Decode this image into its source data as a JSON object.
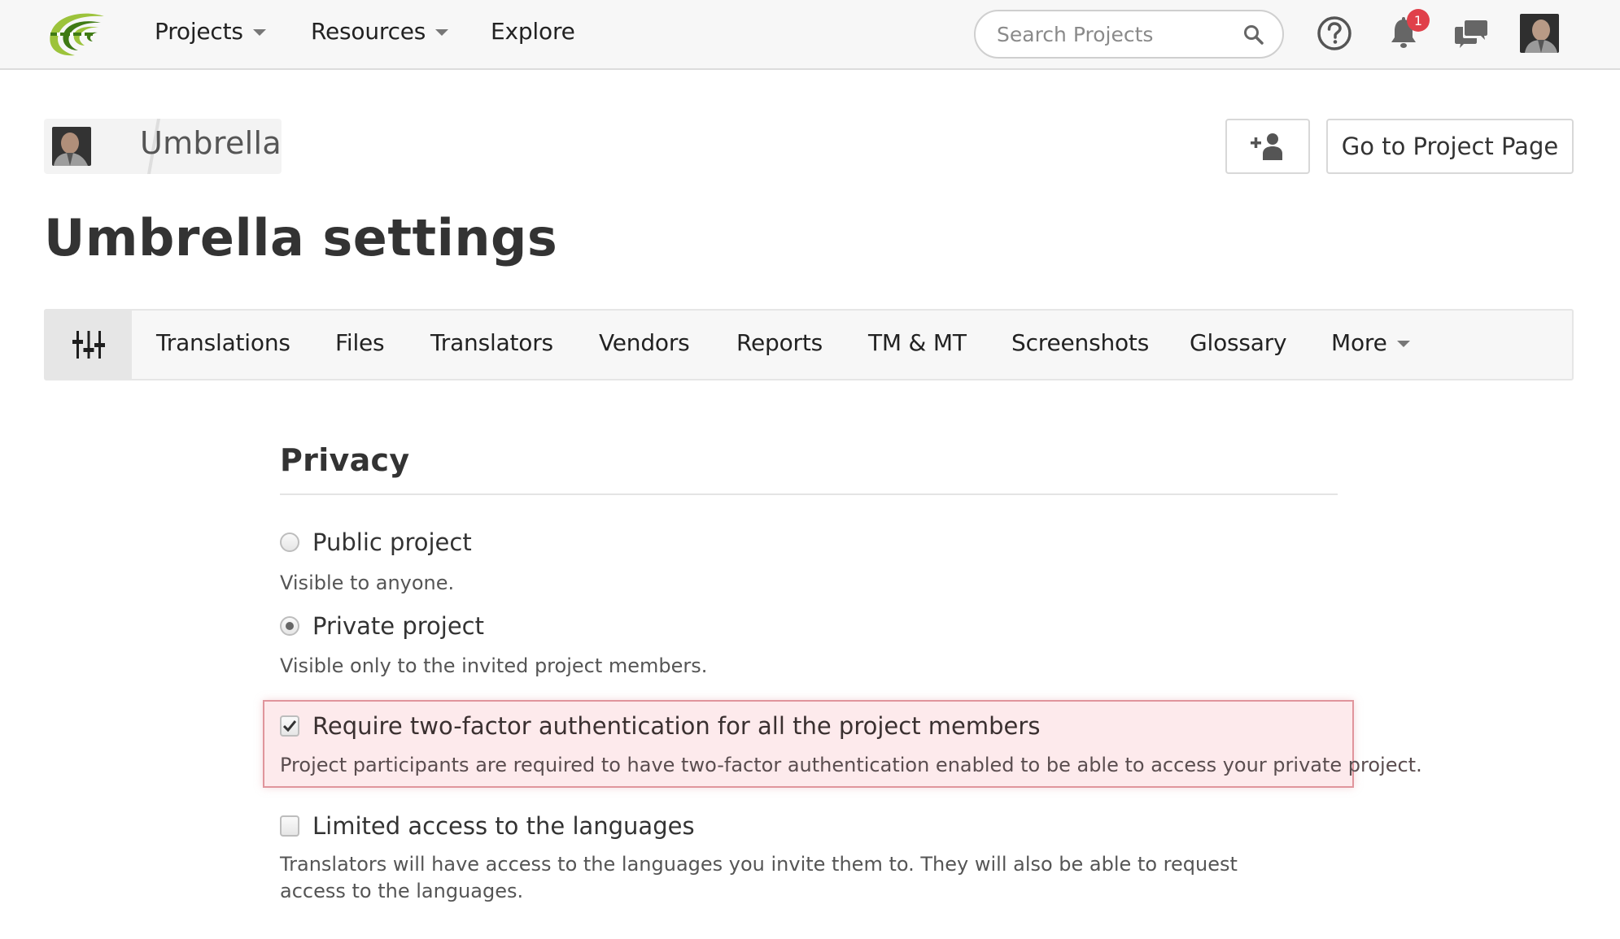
{
  "header": {
    "nav": [
      {
        "label": "Projects",
        "has_dropdown": true
      },
      {
        "label": "Resources",
        "has_dropdown": true
      },
      {
        "label": "Explore",
        "has_dropdown": false
      }
    ],
    "search": {
      "placeholder": "Search Projects",
      "value": ""
    },
    "icons": {
      "help": "help-circle-icon",
      "notifications": "bell-icon",
      "messages": "chat-bubbles-icon",
      "search": "magnifier-icon"
    },
    "notification_count": "1",
    "colors": {
      "badge": "#e0404a",
      "logo_green": "#9cc33b",
      "logo_dark_green": "#3f7a14"
    }
  },
  "breadcrumb": {
    "project_name": "Umbrella"
  },
  "actions": {
    "add_member_icon": "user-plus-icon",
    "go_to_project_label": "Go to Project Page"
  },
  "page": {
    "title": "Umbrella settings"
  },
  "tabs": {
    "settings_icon": "sliders-icon",
    "items": [
      {
        "label": "Translations"
      },
      {
        "label": "Files"
      },
      {
        "label": "Translators"
      },
      {
        "label": "Vendors"
      },
      {
        "label": "Reports"
      },
      {
        "label": "TM & MT"
      },
      {
        "label": "Screenshots"
      },
      {
        "label": "Glossary"
      },
      {
        "label": "More",
        "has_dropdown": true
      }
    ]
  },
  "privacy": {
    "title": "Privacy",
    "options": [
      {
        "label": "Public project",
        "description": "Visible to anyone.",
        "selected": false
      },
      {
        "label": "Private project",
        "description": "Visible only to the invited project members.",
        "selected": true
      }
    ],
    "two_factor": {
      "label": "Require two-factor authentication for all the project members",
      "description": "Project participants are required to have two-factor authentication enabled to be able to access your private project.",
      "checked": true,
      "highlight_bg": "#fdeaec",
      "highlight_border": "#e0959c"
    },
    "limited_access": {
      "label": "Limited access to the languages",
      "description": "Translators will have access to the languages you invite them to. They will also be able to request access to the languages.",
      "checked": false
    }
  }
}
